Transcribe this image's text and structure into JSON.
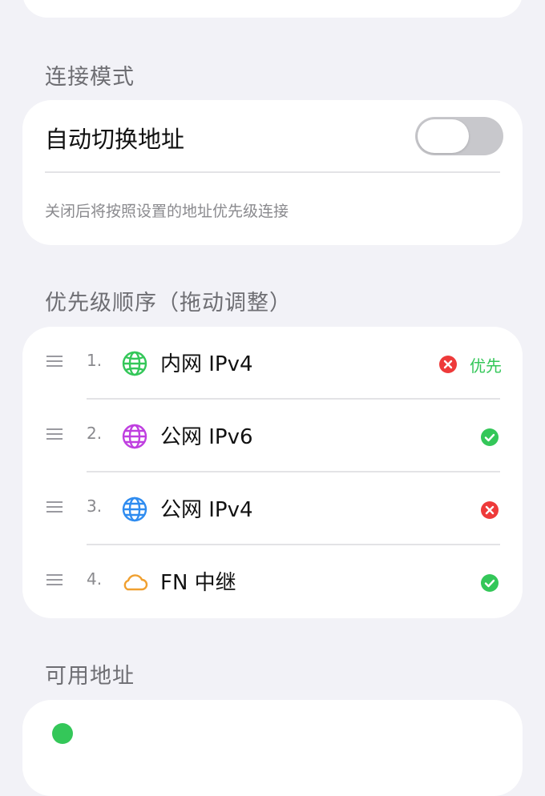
{
  "connection_mode": {
    "section_title": "连接模式",
    "auto_switch_label": "自动切换地址",
    "auto_switch_on": false,
    "hint": "关闭后将按照设置的地址优先级连接"
  },
  "priority": {
    "section_title": "优先级顺序（拖动调整）",
    "items": [
      {
        "index": "1.",
        "label": "内网 IPv4",
        "icon": "globe-icon",
        "icon_color": "#34c759",
        "status": "error",
        "badge": "优先"
      },
      {
        "index": "2.",
        "label": "公网 IPv6",
        "icon": "globe-icon",
        "icon_color": "#bf3fe0",
        "status": "ok",
        "badge": ""
      },
      {
        "index": "3.",
        "label": "公网 IPv4",
        "icon": "globe-icon",
        "icon_color": "#2f8cf0",
        "status": "error",
        "badge": ""
      },
      {
        "index": "4.",
        "label": "FN 中继",
        "icon": "cloud-icon",
        "icon_color": "#f0a030",
        "status": "ok",
        "badge": ""
      }
    ]
  },
  "available": {
    "section_title": "可用地址"
  },
  "colors": {
    "ok": "#34c759",
    "error": "#ee3a3a",
    "background": "#f2f2f7"
  }
}
